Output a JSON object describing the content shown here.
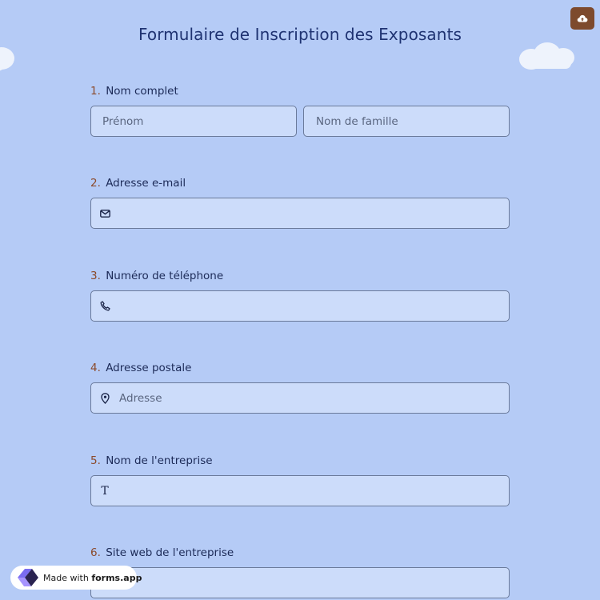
{
  "form": {
    "title": "Formulaire de Inscription des Exposants"
  },
  "questions": [
    {
      "number": "1.",
      "label": "Nom complet",
      "first_placeholder": "Prénom",
      "last_placeholder": "Nom de famille"
    },
    {
      "number": "2.",
      "label": "Adresse e-mail",
      "icon": "envelope-icon"
    },
    {
      "number": "3.",
      "label": "Numéro de téléphone",
      "icon": "phone-icon"
    },
    {
      "number": "4.",
      "label": "Adresse postale",
      "icon": "map-pin-icon",
      "placeholder": "Adresse"
    },
    {
      "number": "5.",
      "label": "Nom de l'entreprise",
      "icon": "text-icon"
    },
    {
      "number": "6.",
      "label": "Site web de l'entreprise"
    }
  ],
  "badge": {
    "prefix": "Made with",
    "brand": "forms.app",
    "icon": "forms-app-logo"
  },
  "corner_button": {
    "icon": "cloud-upload-icon"
  },
  "colors": {
    "background": "#b5cbf6",
    "field_bg": "#ccdcfa",
    "title": "#1f3372",
    "number_accent": "#8b4a2b",
    "corner_button": "#7d4a2d"
  }
}
